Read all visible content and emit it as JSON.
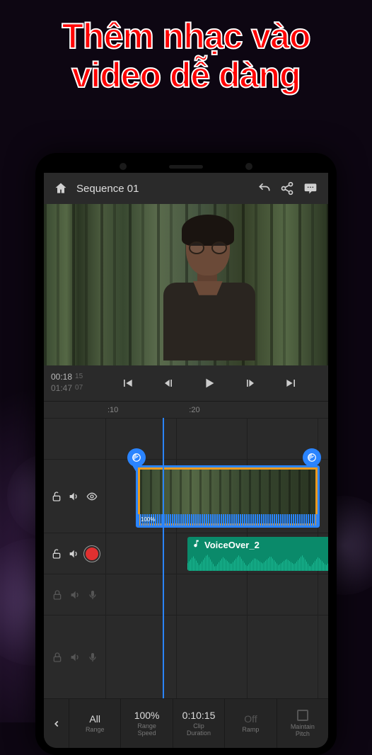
{
  "marketing": {
    "title_line1": "Thêm nhạc vào",
    "title_line2": "video dễ dàng"
  },
  "topbar": {
    "sequence_title": "Sequence 01"
  },
  "transport": {
    "current_time": "00:18",
    "current_frame": "15",
    "total_time": "01:47",
    "total_frame": "07"
  },
  "ruler": {
    "tick1": ":10",
    "tick2": ":20"
  },
  "video_clip": {
    "speed_label": "100%"
  },
  "audio_clip": {
    "label": "VoiceOver_2"
  },
  "bottombar": {
    "range": {
      "value": "All",
      "label": "Range"
    },
    "speed": {
      "value": "100%",
      "label": "Range\nSpeed"
    },
    "duration": {
      "value": "0:10:15",
      "label": "Clip\nDuration"
    },
    "ramp": {
      "value": "Off",
      "label": "Ramp"
    },
    "pitch": {
      "label": "Maintain\nPitch"
    }
  }
}
